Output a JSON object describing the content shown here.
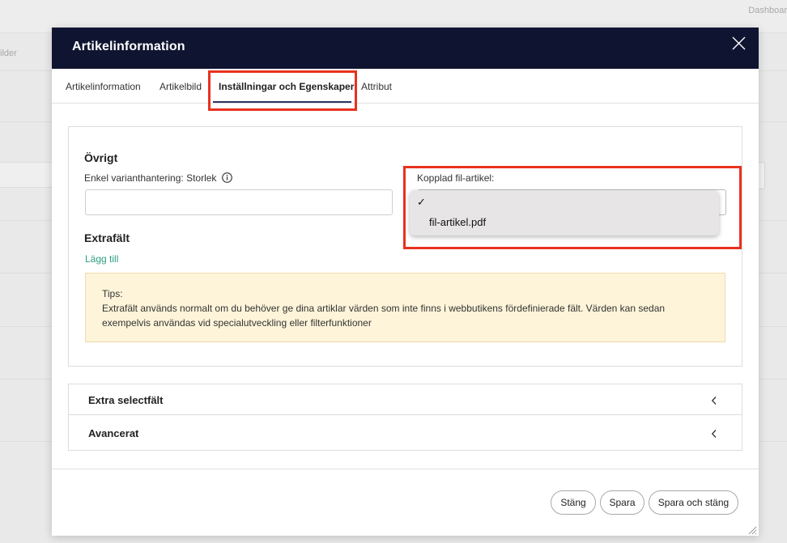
{
  "background": {
    "top_right_text": "Dashboar",
    "left_text": "ilder"
  },
  "modal": {
    "title": "Artikelinformation",
    "close_icon": "close-icon",
    "tabs": [
      {
        "label": "Artikelinformation",
        "active": false
      },
      {
        "label": "Artikelbild",
        "active": false
      },
      {
        "label": "Inställningar och Egenskaper",
        "active": true
      },
      {
        "label": "Attribut",
        "active": false
      }
    ],
    "ovrigt": {
      "title": "Övrigt",
      "variant_label": "Enkel varianthantering: Storlek",
      "variant_value": "",
      "info_icon": "info-icon",
      "linked_file_label": "Kopplad fil-artikel:",
      "dropdown": {
        "checkmark": "✓",
        "options": [
          "fil-artikel.pdf"
        ]
      }
    },
    "extrafalt": {
      "title": "Extrafält",
      "add_link": "Lägg till",
      "tips_title": "Tips:",
      "tips_text": "Extrafält används normalt om du behöver ge dina artiklar värden som inte finns i webbutikens fördefinierade fält. Värden kan sedan exempelvis användas vid specialutveckling eller filterfunktioner"
    },
    "accordions": [
      {
        "label": "Extra selectfält"
      },
      {
        "label": "Avancerat"
      }
    ],
    "buttons": {
      "close": "Stäng",
      "save": "Spara",
      "save_close": "Spara och stäng"
    },
    "colors": {
      "header_bg": "#0f1531",
      "highlight": "#e8321e",
      "link": "#2e9e7f",
      "tips_bg": "#fdf4d9"
    }
  }
}
